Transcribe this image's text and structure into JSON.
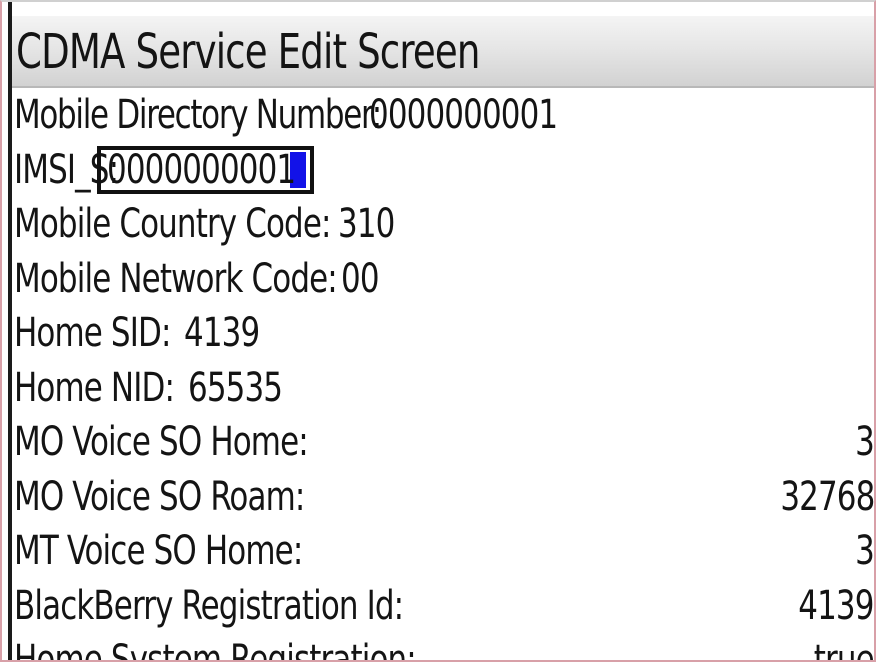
{
  "screen": {
    "title": "CDMA Service Edit Screen"
  },
  "fields": {
    "mdn": {
      "label": "Mobile Directory Number:",
      "value": "0000000001"
    },
    "imsi": {
      "label": "IMSI_S:",
      "value": "0000000001"
    },
    "mcc": {
      "label": "Mobile Country Code:",
      "value": "310"
    },
    "mnc": {
      "label": "Mobile Network Code:",
      "value": "00"
    },
    "home_sid": {
      "label": "Home SID:",
      "value": "4139"
    },
    "home_nid": {
      "label": "Home NID:",
      "value": "65535"
    },
    "mo_voice_home": {
      "label": "MO Voice SO Home:",
      "value": "3"
    },
    "mo_voice_roam": {
      "label": "MO Voice SO Roam:",
      "value": "32768"
    },
    "mt_voice_home": {
      "label": "MT Voice SO Home:",
      "value": "3"
    },
    "bb_reg_id": {
      "label": "BlackBerry Registration Id:",
      "value": "4139"
    },
    "home_sys_reg": {
      "label": "Home System Registration:",
      "value": "true"
    }
  },
  "colors": {
    "cursor": "#1212e8",
    "text": "#141414",
    "titlebar": "#e6e6e6"
  }
}
